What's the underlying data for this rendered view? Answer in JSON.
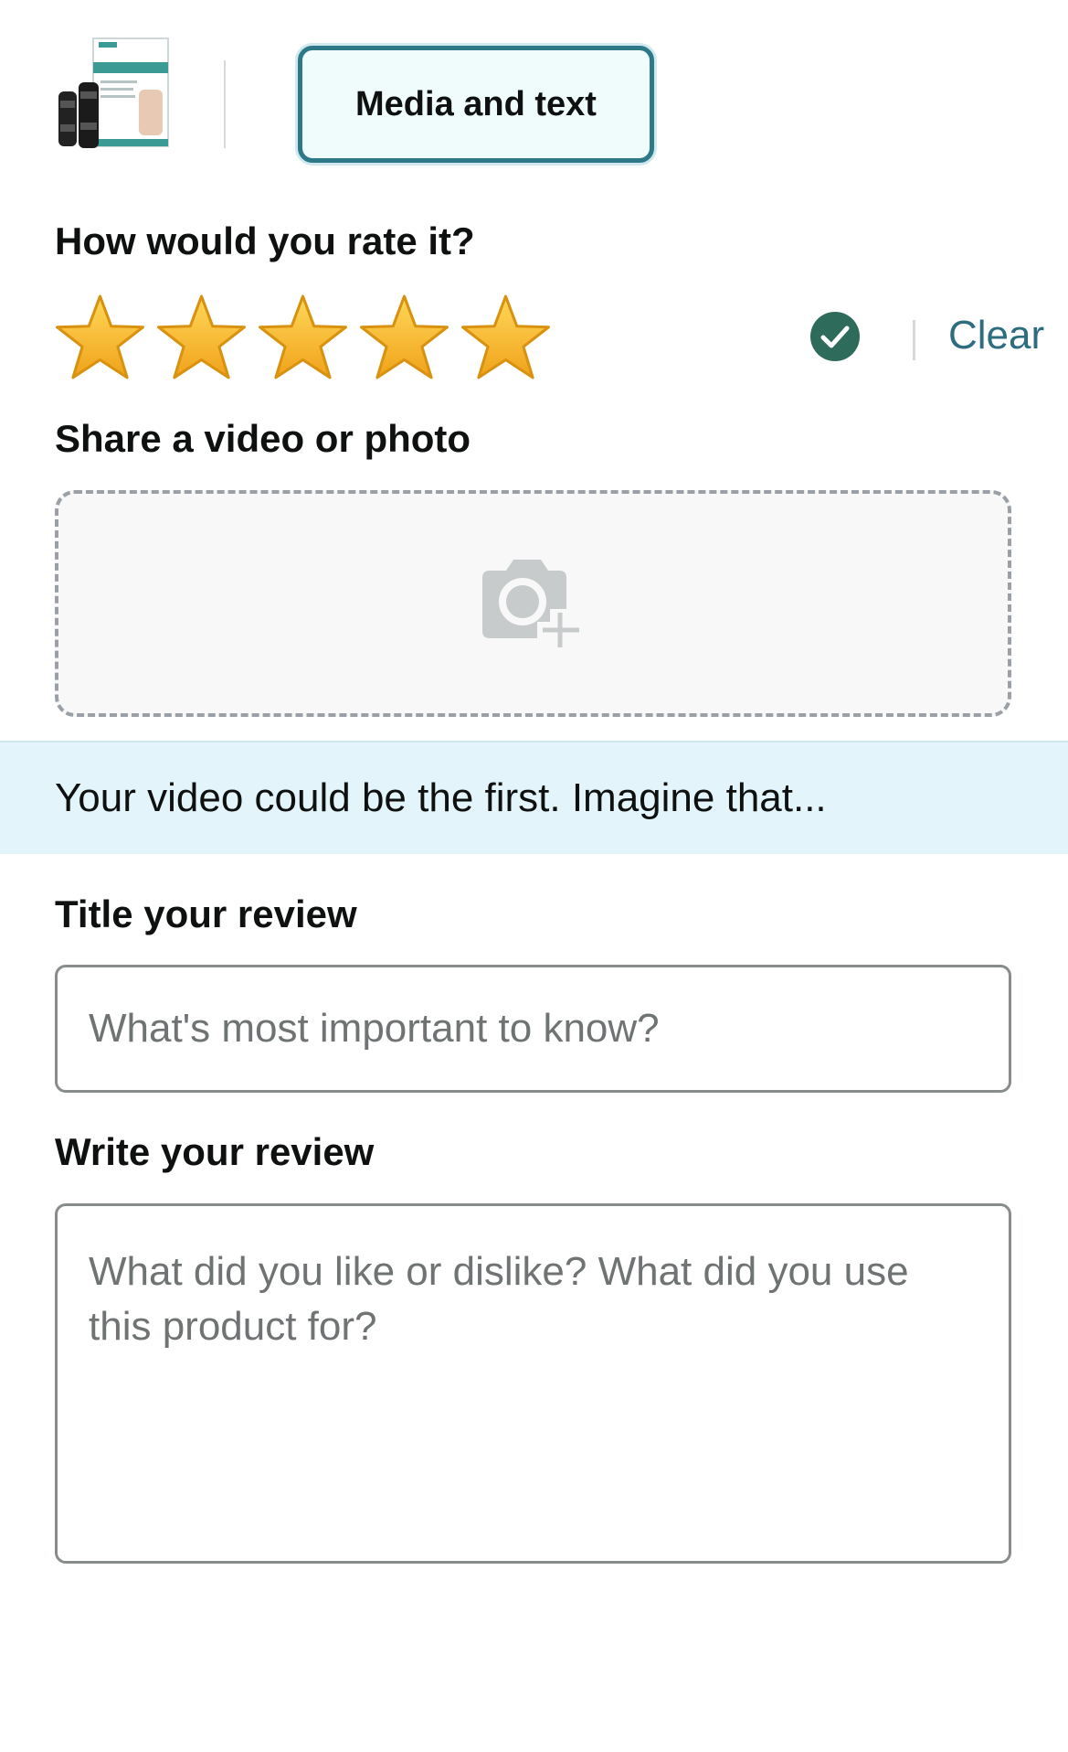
{
  "top": {
    "media_text_label": "Media and text"
  },
  "rating": {
    "heading": "How would you rate it?",
    "value": 5,
    "max": 5,
    "clear_label": "Clear"
  },
  "upload": {
    "heading": "Share a video or photo"
  },
  "banner": {
    "text": "Your video could be the first. Imagine that..."
  },
  "title_field": {
    "heading": "Title your review",
    "placeholder": "What's most important to know?",
    "value": ""
  },
  "review_field": {
    "heading": "Write your review",
    "placeholder": "What did you like or dislike? What did you use this product for?",
    "value": ""
  },
  "colors": {
    "accent_teal": "#2e7887",
    "link": "#2e6d80",
    "check_green": "#2f6b5b",
    "star_gold": "#f5b626",
    "banner_bg": "#e3f5fa"
  },
  "icons": [
    "product-thumbnail",
    "star-icon",
    "check-circle-icon",
    "camera-plus-icon"
  ]
}
